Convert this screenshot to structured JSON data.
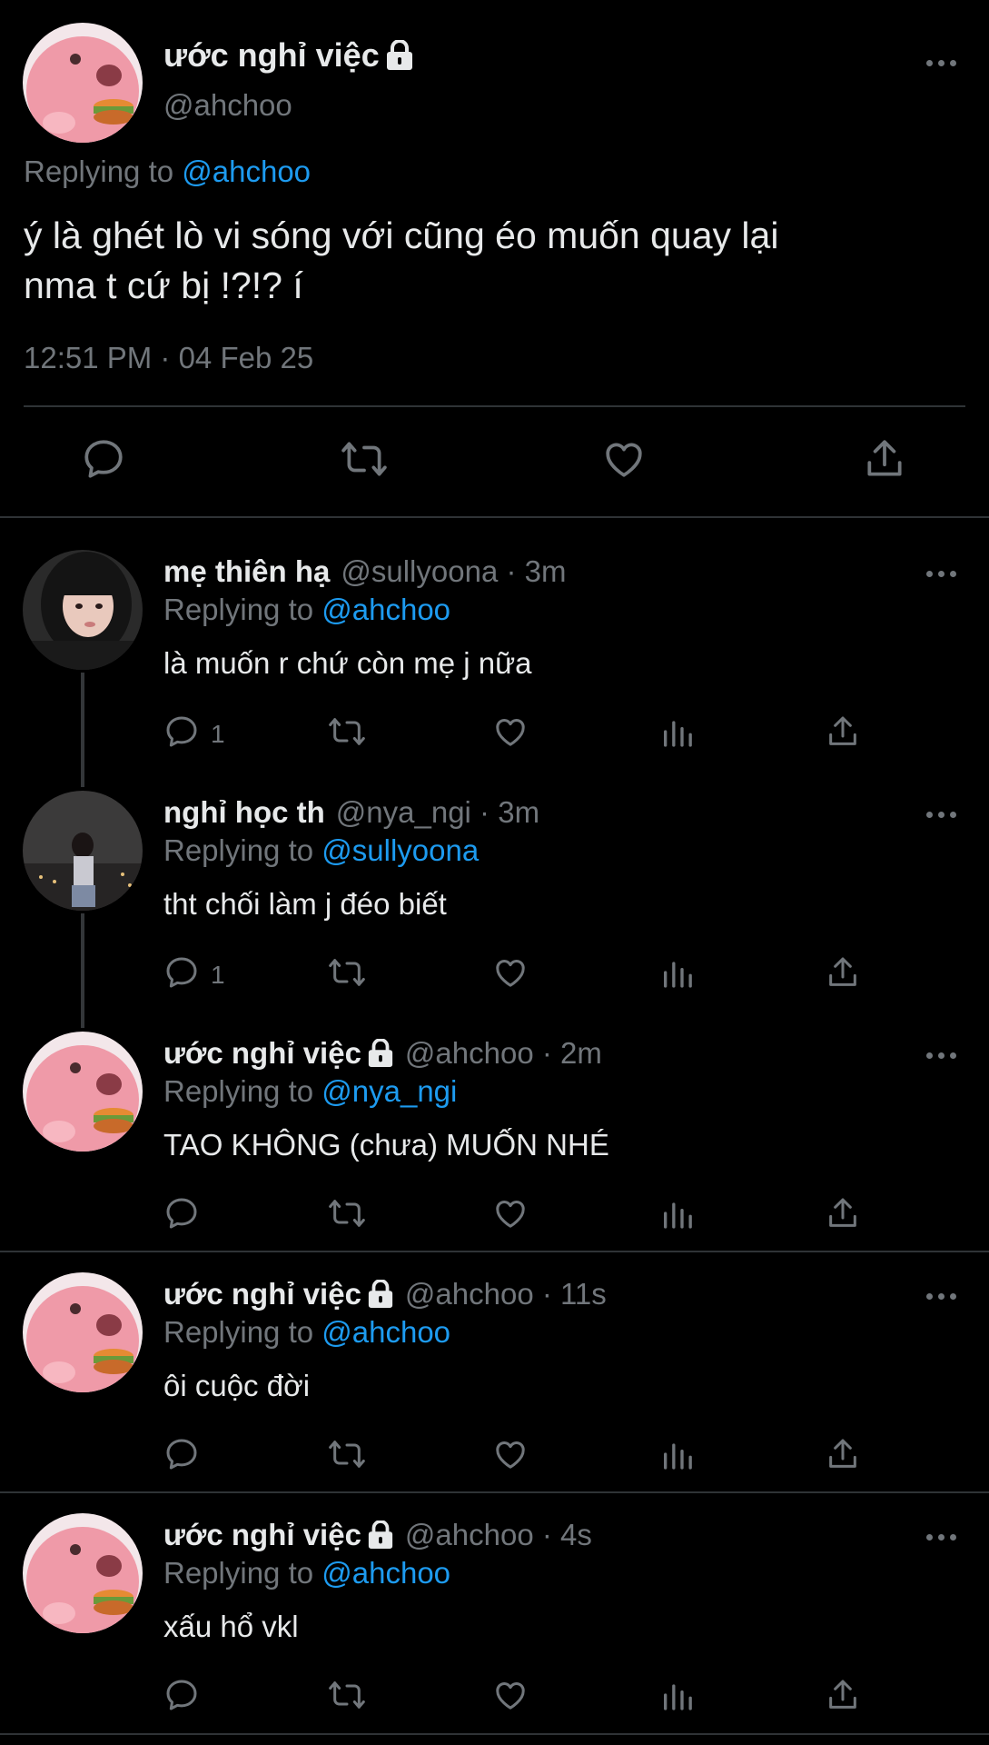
{
  "colors": {
    "background": "#000000",
    "text": "#e7e9ea",
    "muted": "#71767b",
    "link": "#1d9bf0",
    "divider": "#2f3336"
  },
  "main_tweet": {
    "name": "ước nghỉ việc",
    "handle": "@ahchoo",
    "replying_prefix": "Replying to ",
    "replying_to": "@ahchoo",
    "text_line1": "ý là ghét lò vi sóng với cũng éo muốn quay lại",
    "text_line2": "nma t cứ bị !?!? í",
    "timestamp": "12:51 PM · 04 Feb 25",
    "icons": [
      "reply-icon",
      "retweet-icon",
      "like-icon",
      "share-icon"
    ]
  },
  "replies": [
    {
      "name": "mẹ thiên hạ",
      "meta": "@sullyoona · 3m",
      "locked": false,
      "replying_prefix": "Replying to ",
      "replying_to": "@ahchoo",
      "text": "là muốn r chứ còn mẹ j nữa",
      "reply_count": "1"
    },
    {
      "name": "nghỉ học th",
      "meta": "@nya_ngi · 3m",
      "locked": false,
      "replying_prefix": "Replying to ",
      "replying_to": "@sullyoona",
      "text": "tht chối làm j đéo biết",
      "reply_count": "1"
    },
    {
      "name": "ước nghỉ việc",
      "meta": "@ahchoo · 2m",
      "locked": true,
      "replying_prefix": "Replying to ",
      "replying_to": "@nya_ngi",
      "text": "TAO KHÔNG (chưa) MUỐN NHÉ",
      "reply_count": ""
    },
    {
      "name": "ước nghỉ việc",
      "meta": "@ahchoo · 11s",
      "locked": true,
      "replying_prefix": "Replying to ",
      "replying_to": "@ahchoo",
      "text": "ôi cuộc đời",
      "reply_count": ""
    },
    {
      "name": "ước nghỉ việc",
      "meta": "@ahchoo · 4s",
      "locked": true,
      "replying_prefix": "Replying to ",
      "replying_to": "@ahchoo",
      "text": "xấu hổ vkl",
      "reply_count": ""
    }
  ],
  "reply_icons": [
    "reply-icon",
    "retweet-icon",
    "like-icon",
    "views-icon",
    "share-icon"
  ]
}
